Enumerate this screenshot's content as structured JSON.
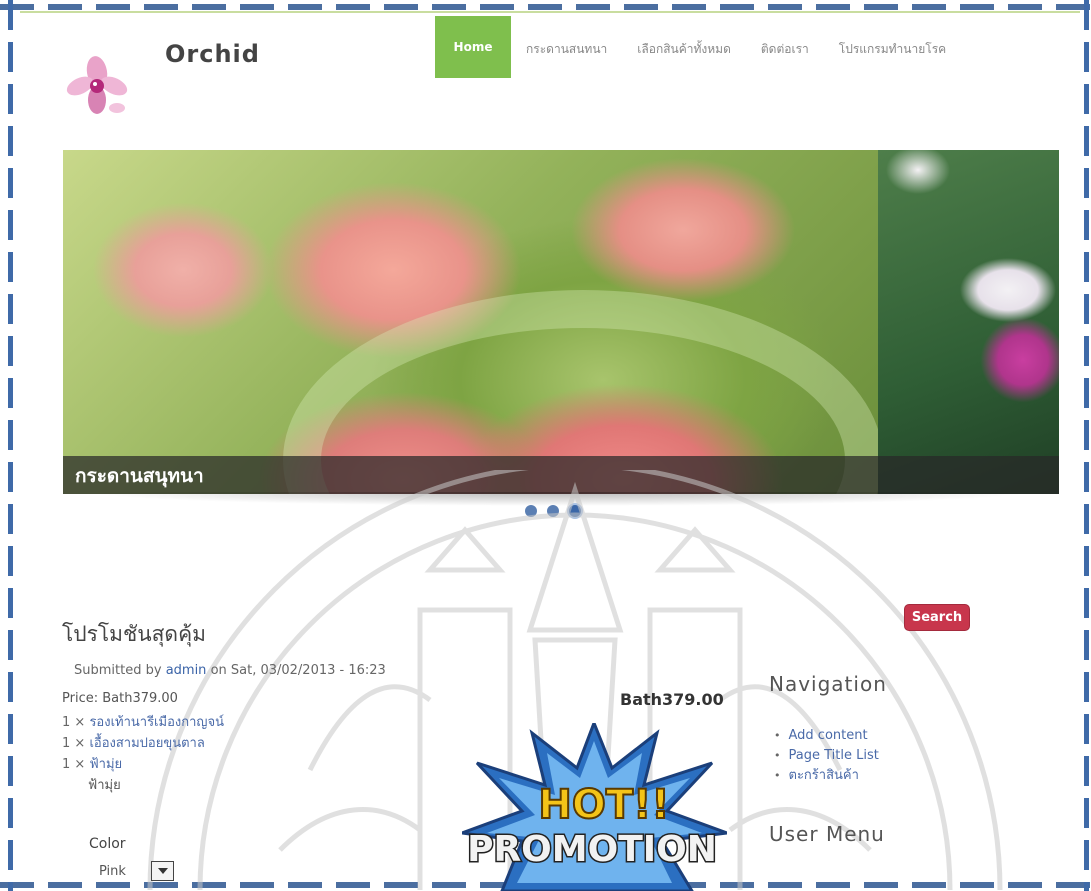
{
  "site": {
    "name": "Orchid"
  },
  "nav": {
    "items": [
      {
        "label": "Home",
        "active": true
      },
      {
        "label": "กระดานสนทนา",
        "active": false
      },
      {
        "label": "เลือกสินค้าทั้งหมด",
        "active": false
      },
      {
        "label": "ติดต่อเรา",
        "active": false
      },
      {
        "label": "โปรแกรมทำนายโรค",
        "active": false
      }
    ]
  },
  "slider": {
    "caption": "กระดานสนุทนา",
    "dot_count": 3,
    "active_dot": 3
  },
  "node": {
    "title": "โปรโมชันสุดคุ้ม",
    "submitted_prefix": "Submitted by",
    "author": "admin",
    "submitted_suffix": "on Sat, 03/02/2013 - 16:23",
    "price_line": "Price: Bath379.00",
    "items": [
      {
        "qty": "1 ×",
        "name": "รองเท้านารีเมืองกาญจน์"
      },
      {
        "qty": "1 ×",
        "name": "เอื้องสามปอยขุนตาล"
      },
      {
        "qty": "1 ×",
        "name": "ฟ้ามุ่ย"
      }
    ],
    "item_sub": "ฟ้ามุ่ย",
    "color_label": "Color",
    "color_value": "Pink",
    "product_price": "Bath379.00",
    "promo_line1": "HOT!!",
    "promo_line2": "PROMOTION"
  },
  "sidebar": {
    "search_label": "Search",
    "navigation_title": "Navigation",
    "navigation_items": [
      "Add content",
      "Page Title List",
      "ตะกร้าสินค้า"
    ],
    "user_menu_title": "User Menu"
  },
  "colors": {
    "nav_active": "#7fbf4d",
    "search_button": "#c8364c",
    "link": "#4a6aa8",
    "frame": "#3f6aa8"
  }
}
